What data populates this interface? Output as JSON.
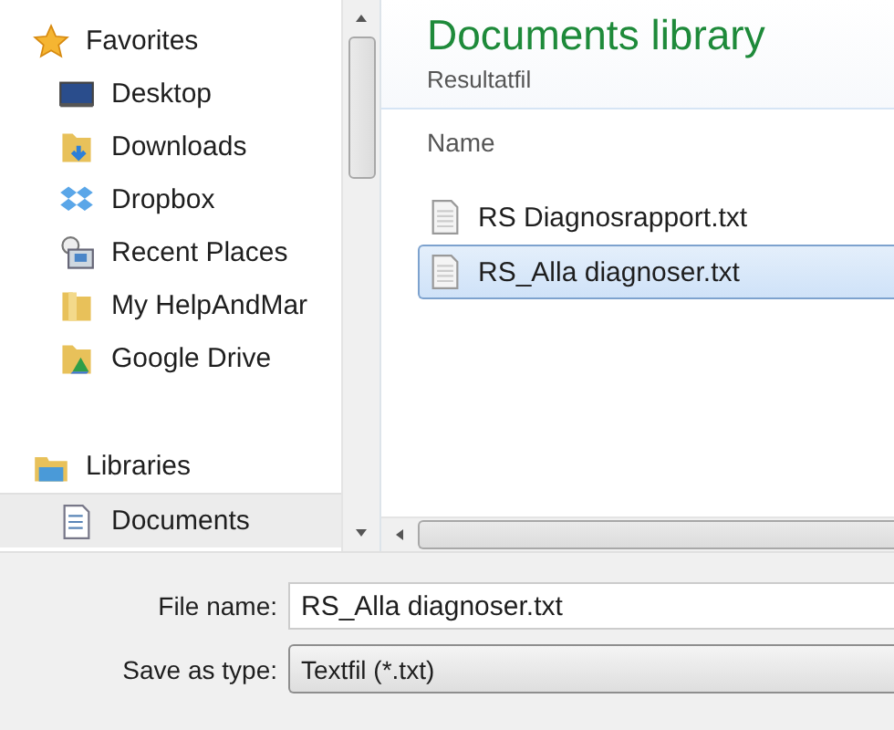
{
  "nav": [
    {
      "label": "Favorites",
      "kind": "header",
      "selected": false
    },
    {
      "label": "Desktop",
      "kind": "item",
      "selected": false
    },
    {
      "label": "Downloads",
      "kind": "item",
      "selected": false
    },
    {
      "label": "Dropbox",
      "kind": "item",
      "selected": false
    },
    {
      "label": "Recent Places",
      "kind": "item",
      "selected": false
    },
    {
      "label": "My HelpAndMar",
      "kind": "item",
      "selected": false
    },
    {
      "label": "Google Drive",
      "kind": "item",
      "selected": false
    },
    {
      "label": "Libraries",
      "kind": "header",
      "selected": false
    },
    {
      "label": "Documents",
      "kind": "item",
      "selected": true
    }
  ],
  "library": {
    "title": "Documents library",
    "subtitle": "Resultatfil"
  },
  "columns": [
    "Name"
  ],
  "files": [
    {
      "name": "RS Diagnosrapport.txt",
      "selected": false
    },
    {
      "name": "RS_Alla diagnoser.txt",
      "selected": true
    }
  ],
  "file_name": {
    "label": "File name:",
    "value": "RS_Alla diagnoser.txt"
  },
  "save_as_type": {
    "label": "Save as type:",
    "value": "Textfil (*.txt)"
  }
}
